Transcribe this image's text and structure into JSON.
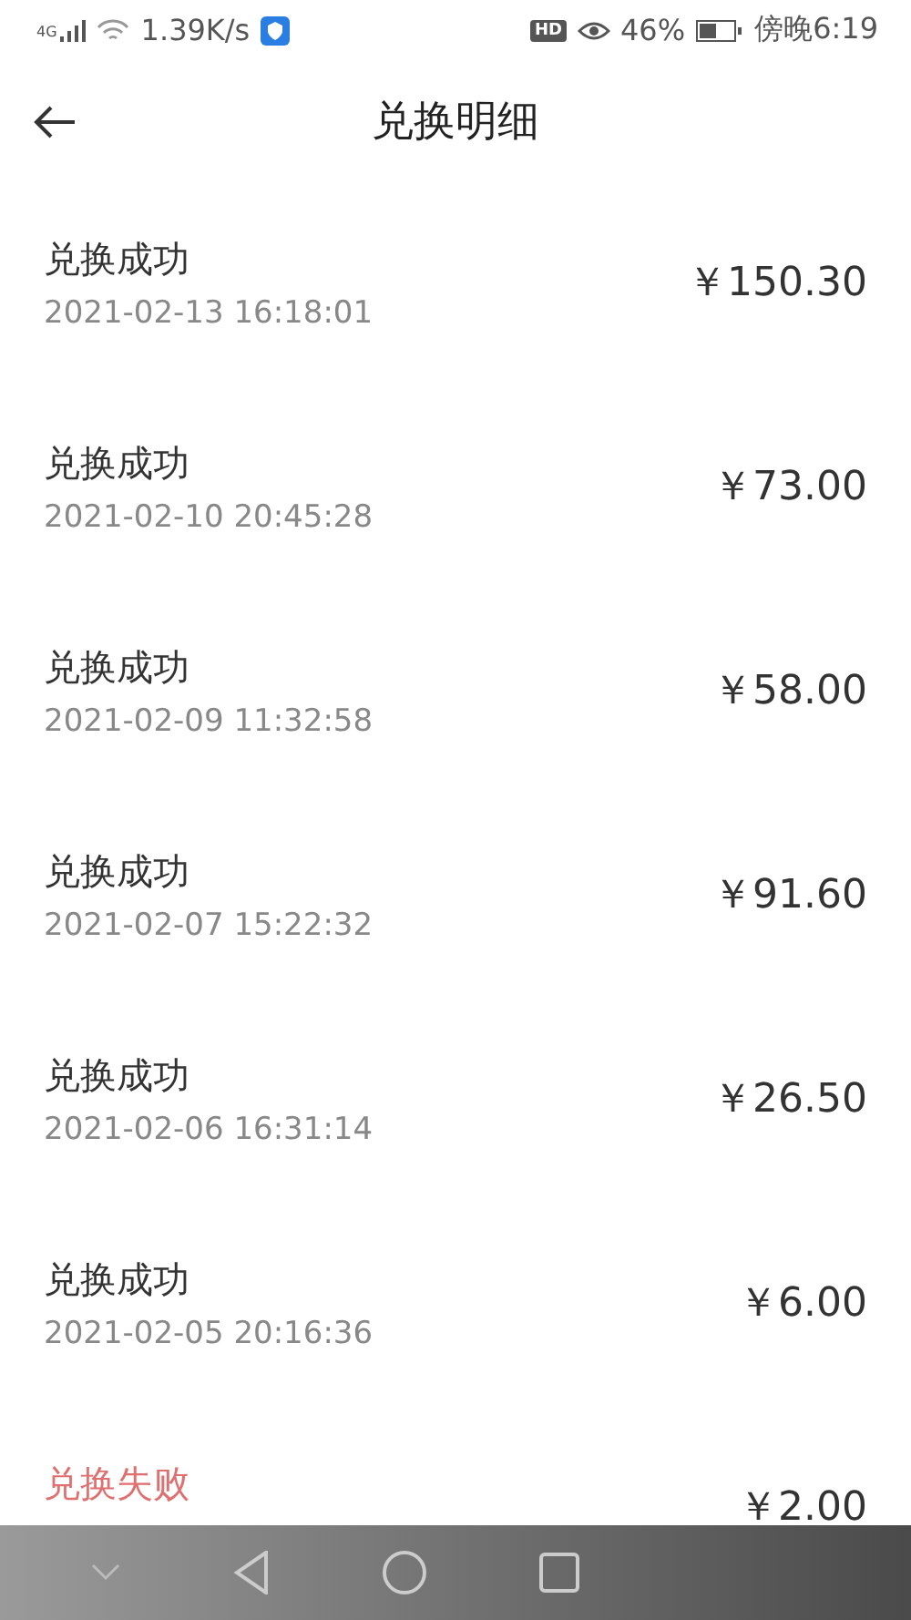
{
  "status_bar": {
    "network": "4G",
    "speed": "1.39K/s",
    "hd": "HD",
    "battery": "46%",
    "time": "傍晚6:19"
  },
  "header": {
    "title": "兑换明细"
  },
  "records": [
    {
      "kind": "success",
      "status": "兑换成功",
      "time": "2021-02-13 16:18:01",
      "amount": "￥150.30"
    },
    {
      "kind": "success",
      "status": "兑换成功",
      "time": "2021-02-10 20:45:28",
      "amount": "￥73.00"
    },
    {
      "kind": "success",
      "status": "兑换成功",
      "time": "2021-02-09 11:32:58",
      "amount": "￥58.00"
    },
    {
      "kind": "success",
      "status": "兑换成功",
      "time": "2021-02-07 15:22:32",
      "amount": "￥91.60"
    },
    {
      "kind": "success",
      "status": "兑换成功",
      "time": "2021-02-06 16:31:14",
      "amount": "￥26.50"
    },
    {
      "kind": "success",
      "status": "兑换成功",
      "time": "2021-02-05 20:16:36",
      "amount": "￥6.00"
    },
    {
      "kind": "failed",
      "status": "兑换失败",
      "amount": "￥2.00"
    }
  ]
}
